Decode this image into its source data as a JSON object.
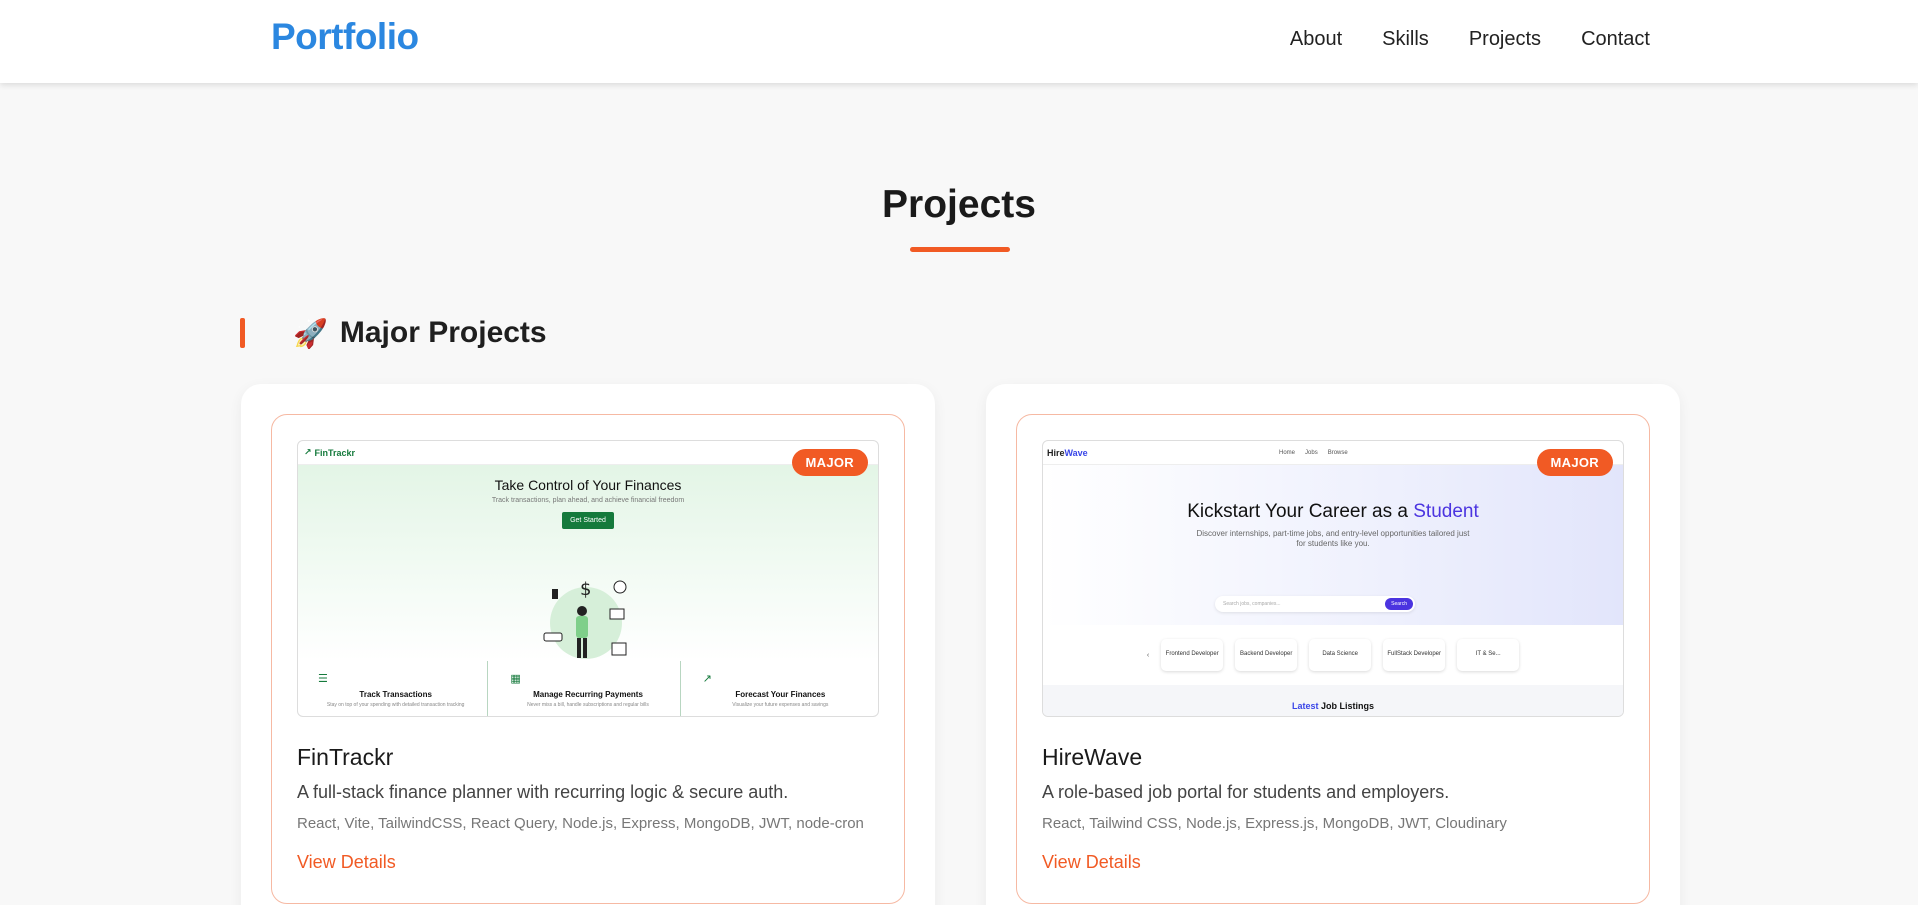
{
  "header": {
    "logo": "Portfolio",
    "nav": [
      "About",
      "Skills",
      "Projects",
      "Contact"
    ]
  },
  "section": {
    "title": "Projects",
    "subheading": "Major Projects",
    "subheading_icon": "rocket-icon"
  },
  "colors": {
    "accent": "#f15a24",
    "brand": "#2b87e0",
    "fintrackr_green": "#157a3c",
    "hirewave_purple": "#4b34e0"
  },
  "projects": [
    {
      "badge": "MAJOR",
      "name": "FinTrackr",
      "description": "A full-stack finance planner with recurring logic & secure auth.",
      "tech": "React, Vite, TailwindCSS, React Query, Node.js, Express, MongoDB, JWT, node-cron",
      "link": "View Details",
      "screenshot": {
        "brand": "FinTrackr",
        "hero_title": "Take Control of Your Finances",
        "hero_subtitle": "Track transactions, plan ahead, and achieve financial freedom",
        "cta": "Get Started",
        "features": [
          {
            "title": "Track Transactions",
            "text": "Stay on top of your spending with detailed transaction tracking"
          },
          {
            "title": "Manage Recurring Payments",
            "text": "Never miss a bill, handle subscriptions and regular bills"
          },
          {
            "title": "Forecast Your Finances",
            "text": "Visualize your future expenses and savings"
          }
        ]
      }
    },
    {
      "badge": "MAJOR",
      "name": "HireWave",
      "description": "A role-based job portal for students and employers.",
      "tech": "React, Tailwind CSS, Node.js, Express.js, MongoDB, JWT, Cloudinary",
      "link": "View Details",
      "screenshot": {
        "brand_part1": "Hire",
        "brand_part2": "Wave",
        "menu": [
          "Home",
          "Jobs",
          "Browse"
        ],
        "hero_title_prefix": "Kickstart Your Career as a",
        "hero_title_accent": "Student",
        "hero_subtitle": "Discover internships, part-time jobs, and entry-level opportunities tailored just for students like you.",
        "search_placeholder": "Search jobs, companies...",
        "search_button": "Search",
        "categories": [
          "Frontend Developer",
          "Backend Developer",
          "Data Science",
          "FullStack Developer",
          "IT & Se..."
        ],
        "latest_accent": "Latest",
        "latest_rest": "Job Listings"
      }
    }
  ]
}
